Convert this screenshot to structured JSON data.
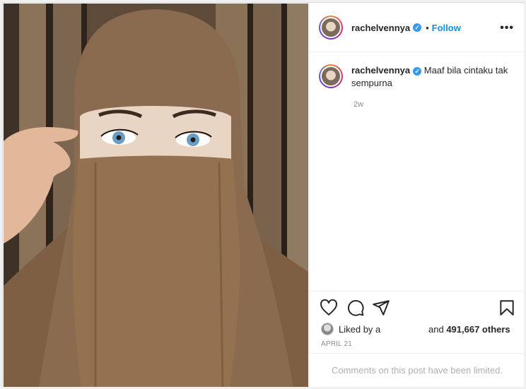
{
  "post": {
    "username": "rachelvennya",
    "verified_icon": "verified-badge-icon",
    "follow_label": "Follow",
    "separator": "•",
    "more_label": "•••",
    "caption": "Maaf bila cintaku tak sempurna",
    "time_ago": "2w",
    "liked_by_label": "Liked by",
    "liked_by_user": "a",
    "others_prefix": "and",
    "others_count": "491,667 others",
    "date": "APRIL 21",
    "comments_notice": "Comments on this post have been limited."
  },
  "icons": {
    "like": "heart-icon",
    "comment": "comment-icon",
    "share": "share-icon",
    "save": "bookmark-icon"
  },
  "colors": {
    "follow": "#0095f6",
    "verified": "#3897f0",
    "hijab": "#8b6b4f",
    "background_wood": "#6f5a45"
  }
}
